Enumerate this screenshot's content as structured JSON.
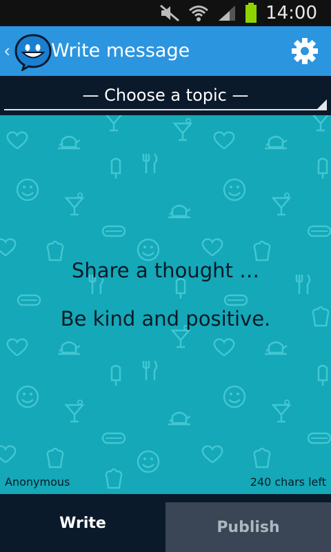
{
  "status_bar": {
    "time": "14:00",
    "icons": [
      "mute-icon",
      "wifi-icon",
      "signal-icon",
      "battery-icon"
    ],
    "battery_color": "#8fd400"
  },
  "action_bar": {
    "title": "Write message",
    "back_icon": "chevron-left-icon",
    "logo_icon": "smiley-chat-icon",
    "settings_icon": "gear-icon",
    "color": "#2b95e0"
  },
  "topic": {
    "label": "— Choose a topic —"
  },
  "message": {
    "hint_line_1": "Share a thought …",
    "hint_line_2": "Be kind and positive.",
    "author": "Anonymous",
    "chars_left": "240 chars left",
    "background_color": "#14a8b8"
  },
  "tabs": {
    "write_label": "Write",
    "publish_label": "Publish"
  }
}
